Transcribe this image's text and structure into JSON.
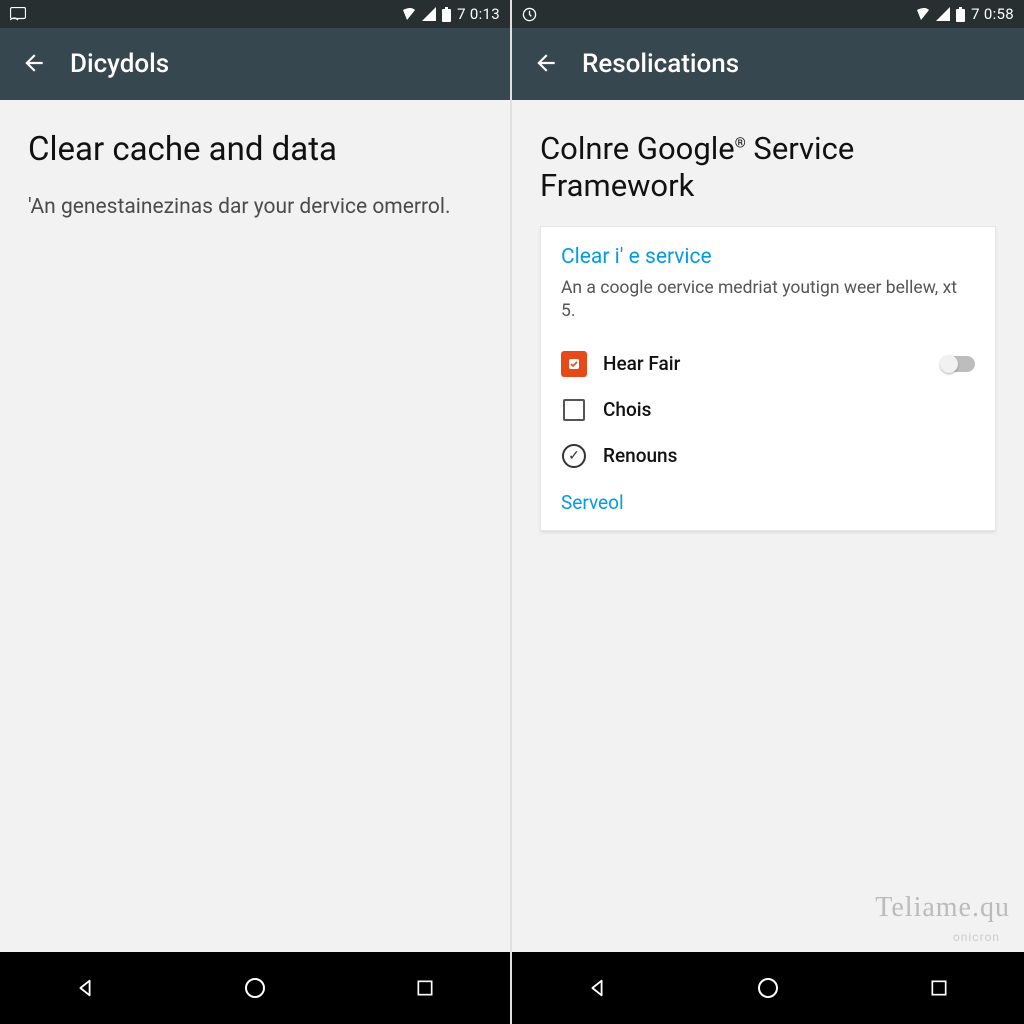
{
  "left": {
    "status": {
      "time": "7 0:13"
    },
    "appbar": {
      "title": "Dicydols"
    },
    "headline": "Clear cache and data",
    "subtext": "'An genestainezinas dar your dervice omerrol."
  },
  "right": {
    "status": {
      "time": "7 0:58"
    },
    "appbar": {
      "title": "Resolications"
    },
    "headline_pre": "Colnre Google",
    "headline_post": " Service Framework",
    "card": {
      "title": "Clear i' e service",
      "desc": "An a coogle oervice medriat youtign weer bellew, xt 5.",
      "items": [
        {
          "label": "Hear Fair"
        },
        {
          "label": "Chois"
        },
        {
          "label": "Renouns"
        }
      ],
      "link": "Serveol"
    },
    "watermark": "Teliame.qu",
    "watermark_sub": "onicron"
  }
}
